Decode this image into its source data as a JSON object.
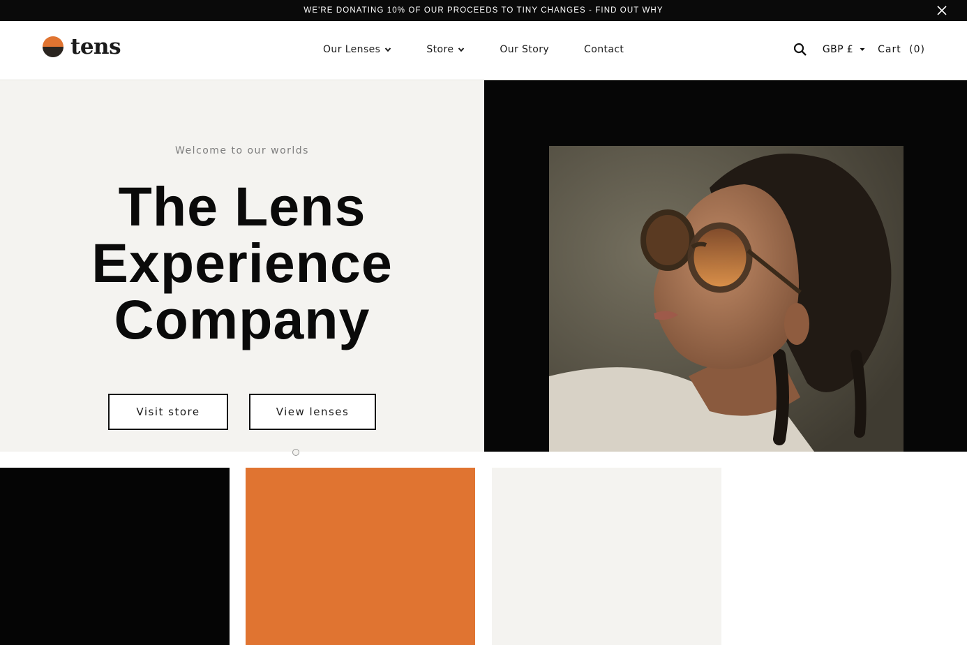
{
  "announcement": {
    "text": "WE'RE DONATING 10% OF OUR PROCEEDS TO TINY CHANGES - FIND OUT WHY",
    "close_icon": "close-icon"
  },
  "header": {
    "logo_text": "tens",
    "nav": [
      {
        "label": "Our Lenses",
        "has_dropdown": true
      },
      {
        "label": "Store",
        "has_dropdown": true
      },
      {
        "label": "Our Story",
        "has_dropdown": false
      },
      {
        "label": "Contact",
        "has_dropdown": false
      }
    ],
    "currency": "GBP £",
    "cart": "Cart",
    "cart_count": "(0)",
    "search_icon": "search-icon"
  },
  "hero": {
    "kicker": "Welcome to our worlds",
    "title_lines": [
      "The Lens",
      "Experience",
      "Company"
    ],
    "buttons": {
      "visit_store": "Visit store",
      "view_lenses": "View lenses"
    }
  },
  "tiles": [
    {
      "color": "#050505"
    },
    {
      "color": "#e07431"
    },
    {
      "color": "#f4f3f0"
    }
  ],
  "colors": {
    "brand_orange": "#e07431",
    "brand_dark": "#0a0a0a",
    "cream": "#f4f3f0"
  }
}
